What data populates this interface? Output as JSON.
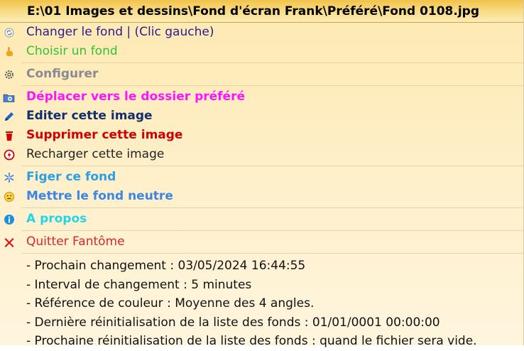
{
  "title": "E:\\01 Images et dessins\\Fond d'écran Frank\\Préféré\\Fond 0108.jpg",
  "colors": {
    "title_bar": "#f2c34a",
    "menu_bg": "#fff0cc",
    "separator": "#e4d3a6"
  },
  "items": [
    {
      "label": "Changer le fond | (Clic gauche)",
      "color": "#2a1b8f",
      "icon": "refresh-icon"
    },
    {
      "label": "Choisir un fond",
      "color": "#33c233",
      "icon": "hand-pointer-icon"
    },
    {
      "label": "Configurer",
      "color": "#8a8a94",
      "icon": "gear-icon"
    },
    {
      "label": "Déplacer vers le dossier préféré",
      "color": "#ff14ff",
      "icon": "folder-star-icon"
    },
    {
      "label": "Editer cette image",
      "color": "#0f2f6e",
      "icon": "pencil-icon"
    },
    {
      "label": "Supprimer cette image",
      "color": "#d10000",
      "icon": "trash-icon"
    },
    {
      "label": "Recharger cette image",
      "color": "#222222",
      "icon": "reload-icon"
    },
    {
      "label": "Figer ce fond",
      "color": "#2b9ee6",
      "icon": "snowflake-icon"
    },
    {
      "label": "Mettre le fond neutre",
      "color": "#3a85e8",
      "icon": "neutral-face-icon"
    },
    {
      "label": "A propos",
      "color": "#22d6e6",
      "icon": "info-icon"
    },
    {
      "label": "Quitter Fantôme",
      "color": "#d8262b",
      "icon": "close-x-icon"
    }
  ],
  "info_lines": [
    "- Prochain changement : 03/05/2024 16:44:55",
    "- Interval de changement : 5 minutes",
    "- Référence de couleur : Moyenne des 4 angles.",
    "- Dernière réinitialisation de la liste des fonds : 01/01/0001 00:00:00",
    "- Prochaine réinitialisation de la liste des fonds : quand le fichier sera vide."
  ]
}
